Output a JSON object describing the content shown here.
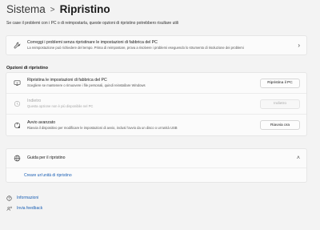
{
  "breadcrumb": {
    "parent": "Sistema",
    "separator": ">",
    "current": "Ripristino"
  },
  "subtitle": "Se case il problemi con i PC o di reimpostarla, queste opzioni di ripristino potrebbero risultare utili",
  "fix_card": {
    "title": "Correggi i problemi senza ripristinare le impostazioni di fabbrica del PC",
    "description": "La reimpostazione può richiedere del tempo. Prima di reimpostare, prova a risolvere i problemi eseguendo lo strumento di risoluzione dei problemi",
    "icon": "wrench-icon"
  },
  "section_label": "Opzioni di ripristino",
  "options": [
    {
      "title": "Ripristina le impostazioni di fabbrica del PC",
      "description": "Scegliere se mantenere o rimuovere i file personali, quindi reinstallare Windows",
      "button": "Ripristina il PC",
      "icon": "reset-pc-icon"
    },
    {
      "title": "Indietro",
      "description": "Questa opzione non è più disponibile nel PC",
      "button": "Indietro",
      "icon": "history-icon"
    },
    {
      "title": "Avvio avanzato",
      "description": "Riavvia il dispositivo per modificare le impostazioni di avvio, inclusi l'avvio da un disco o un'unità USB",
      "button": "Riavvia ora",
      "icon": "advanced-startup-icon"
    }
  ],
  "help": {
    "title": "Guida per il ripristino",
    "link": "Creare un'unità di ripristino",
    "icon": "globe-icon"
  },
  "footer": {
    "info": "Informazioni",
    "feedback": "Invia feedback"
  },
  "colors": {
    "background": "#f3f3f3",
    "card": "#fbfbfb",
    "link": "#1a5fb4"
  }
}
